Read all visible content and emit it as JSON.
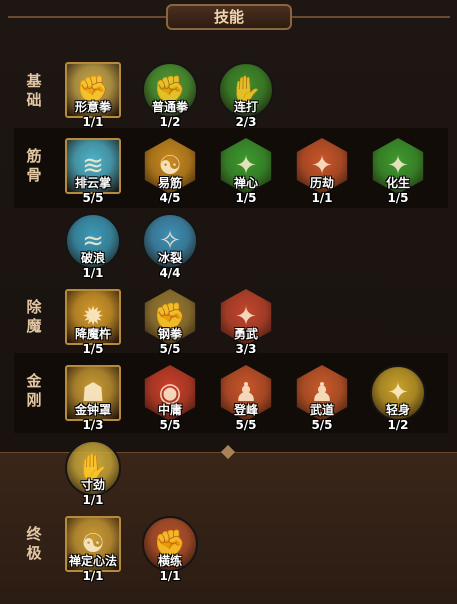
{
  "title": "技能",
  "rows": {
    "jichu": "基\n础",
    "jingu": "筋\n骨",
    "chumo": "除\n魔",
    "jingang": "金\n刚",
    "zhongji": "终\n极"
  },
  "skills": [
    {
      "name": "形意拳",
      "level": "1/1",
      "glyph": "✊",
      "color": "#c8a74a"
    },
    {
      "name": "普通拳",
      "level": "1/2",
      "glyph": "✊",
      "color": "#4e9a33"
    },
    {
      "name": "连打",
      "level": "2/3",
      "glyph": "✋",
      "color": "#3f8c2a"
    },
    {
      "name": "排云掌",
      "level": "5/5",
      "glyph": "≋",
      "color": "#4fb3c9"
    },
    {
      "name": "易筋",
      "level": "4/5",
      "glyph": "☯",
      "color": "#c98a1f"
    },
    {
      "name": "禅心",
      "level": "1/5",
      "glyph": "✦",
      "color": "#3d9a2e"
    },
    {
      "name": "历劫",
      "level": "1/1",
      "glyph": "✦",
      "color": "#c9562a"
    },
    {
      "name": "化生",
      "level": "1/5",
      "glyph": "✦",
      "color": "#3f9a2e"
    },
    {
      "name": "破浪",
      "level": "1/1",
      "glyph": "≈",
      "color": "#3c9ab8"
    },
    {
      "name": "冰裂",
      "level": "4/4",
      "glyph": "✧",
      "color": "#3f8fb5"
    },
    {
      "name": "降魔杵",
      "level": "1/5",
      "glyph": "✹",
      "color": "#d59a2a"
    },
    {
      "name": "钢拳",
      "level": "5/5",
      "glyph": "✊",
      "color": "#9a7b33"
    },
    {
      "name": "勇武",
      "level": "3/3",
      "glyph": "✦",
      "color": "#c2452c"
    },
    {
      "name": "金钟罩",
      "level": "1/3",
      "glyph": "☗",
      "color": "#c99a33"
    },
    {
      "name": "中庸",
      "level": "5/5",
      "glyph": "◉",
      "color": "#c9402a"
    },
    {
      "name": "登峰",
      "level": "5/5",
      "glyph": "♟",
      "color": "#c9552a"
    },
    {
      "name": "武道",
      "level": "5/5",
      "glyph": "♟",
      "color": "#c95a2a"
    },
    {
      "name": "轻身",
      "level": "1/2",
      "glyph": "✦",
      "color": "#c9a22a"
    },
    {
      "name": "寸劲",
      "level": "1/1",
      "glyph": "✋",
      "color": "#c9a83a"
    },
    {
      "name": "禅定心法",
      "level": "1/1",
      "glyph": "☯",
      "color": "#c99a33"
    },
    {
      "name": "横练",
      "level": "1/1",
      "glyph": "✊",
      "color": "#b2502a"
    }
  ]
}
